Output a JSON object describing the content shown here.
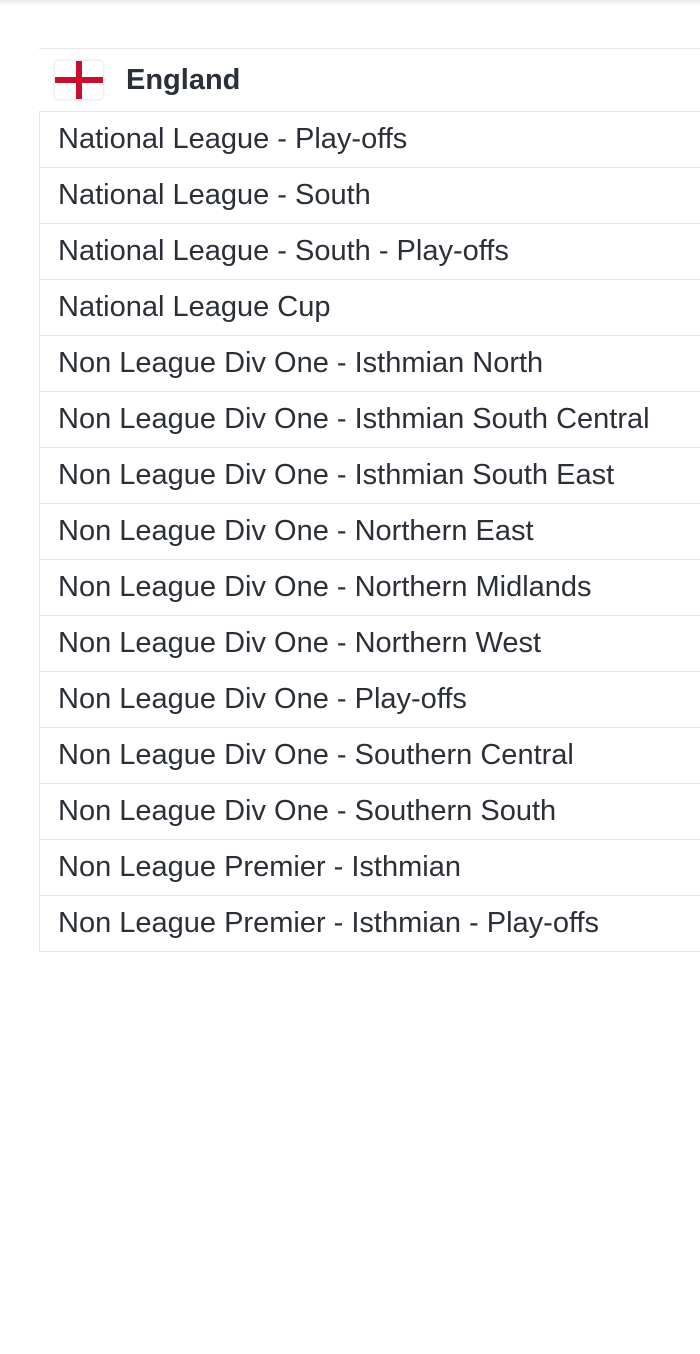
{
  "country": {
    "name": "England",
    "flag_icon": "england-flag-icon",
    "flag_colors": {
      "background": "#ffffff",
      "cross": "#c8102e"
    }
  },
  "leagues": [
    {
      "label": "National League - Play-offs"
    },
    {
      "label": "National League - South"
    },
    {
      "label": "National League - South - Play-offs"
    },
    {
      "label": "National League Cup"
    },
    {
      "label": "Non League Div One - Isthmian North"
    },
    {
      "label": "Non League Div One - Isthmian South Central"
    },
    {
      "label": "Non League Div One - Isthmian South East"
    },
    {
      "label": "Non League Div One - Northern East"
    },
    {
      "label": "Non League Div One - Northern Midlands"
    },
    {
      "label": "Non League Div One - Northern West"
    },
    {
      "label": "Non League Div One - Play-offs"
    },
    {
      "label": "Non League Div One - Southern Central"
    },
    {
      "label": "Non League Div One - Southern South"
    },
    {
      "label": "Non League Premier - Isthmian"
    },
    {
      "label": "Non League Premier - Isthmian - Play-offs"
    }
  ]
}
